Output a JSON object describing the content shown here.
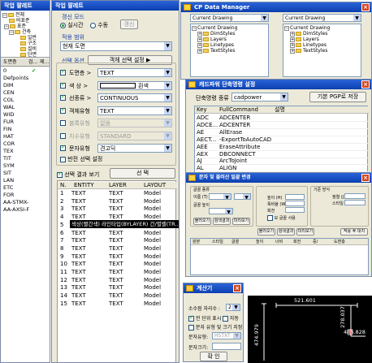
{
  "left_panel": {
    "title": "작업 팔레트",
    "tree": {
      "items": [
        "전체",
        "비표준",
        "표준",
        "건축",
        "일반",
        "구조",
        "설비",
        "단면",
        "도면"
      ],
      "table_headers": [
        "도면층",
        "검...",
        "제..."
      ],
      "layers": [
        "0",
        "Defpoints",
        "DIM",
        "CEN",
        "COL",
        "WAL",
        "WID",
        "FUR",
        "FIN",
        "HAT",
        "COR",
        "TEX",
        "TIT",
        "SYM",
        "SIT",
        "LAN",
        "ETC",
        "FOR",
        "AA-STMX-",
        "AA-AXSI-F"
      ]
    }
  },
  "right_panel": {
    "title": "작업 팔레트",
    "mode_group": "갱신 모드",
    "mode_options": [
      "실시간",
      "수동"
    ],
    "update_button": "갱신",
    "range_group": "적용 범위",
    "range_value": "현재 도면",
    "select_group": "선택 옵션",
    "select_button": "객체 선택 설정 ▶",
    "options": [
      {
        "label": "도면층 >",
        "value": "TEXT",
        "checked": true
      },
      {
        "label": "색    상 >",
        "value": "흰색",
        "checked": true
      },
      {
        "label": "선종류 >",
        "value": "CONTINUOUS",
        "checked": true
      },
      {
        "label": "객체유형",
        "value": "TEXT",
        "checked": true
      },
      {
        "label": "블록유형",
        "value": "없음",
        "checked": false
      },
      {
        "label": "치수유형",
        "value": "STANDARD",
        "checked": false
      },
      {
        "label": "문자유형",
        "value": "견고딕",
        "checked": true
      }
    ],
    "reverse_select": "반전 선택 설정",
    "show_result": "선택 결과 보기",
    "select_action_button": "선 택",
    "result_headers": [
      "N.",
      "ENTITY",
      "LAYER",
      "LAYOUT"
    ],
    "result_rows": [
      [
        "1",
        "TEXT",
        "TEXT",
        "Model"
      ],
      [
        "2",
        "TEXT",
        "TEXT",
        "Model"
      ],
      [
        "3",
        "TEXT",
        "TEXT",
        "Model"
      ],
      [
        "4",
        "TEXT",
        "TEXT",
        "Model"
      ],
      [
        "5",
        "",
        "",
        ""
      ],
      [
        "6",
        "TEXT",
        "TEXT",
        "Model"
      ],
      [
        "7",
        "TEXT",
        "TEXT",
        "Model"
      ],
      [
        "8",
        "TEXT",
        "TEXT",
        "Model"
      ],
      [
        "9",
        "TEXT",
        "TEXT",
        "Model"
      ],
      [
        "10",
        "TEXT",
        "TEXT",
        "Model"
      ],
      [
        "11",
        "TEXT",
        "TEXT",
        "Model"
      ],
      [
        "12",
        "TEXT",
        "TEXT",
        "Model"
      ],
      [
        "13",
        "TEXT",
        "TEXT",
        "Model"
      ],
      [
        "14",
        "TEXT",
        "TEXT",
        "Model"
      ],
      [
        "15",
        "TEXT",
        "TEXT",
        "Model"
      ]
    ],
    "tooltip": "색상(빨간색) 라인타입(BYLAYER) 간/별벨(TR...)"
  },
  "cp_data_manager": {
    "title": "CP Data Manager",
    "left_combo": "Current Drawing",
    "right_combo": "Current Drawing",
    "tree_root": "Current Drawing",
    "tree_children": [
      "DimStyles",
      "Layers",
      "Linetypes",
      "TextStyles"
    ]
  },
  "shortcut_window": {
    "title": "캐드파워 단축명령 설정",
    "type_label": "단축명령 종류",
    "type_value": "cadpower",
    "save_button": "기본 PGP로 저장",
    "headers": [
      "Key",
      "FullCommand",
      "설명"
    ],
    "rows": [
      [
        "ADC",
        "ADCENTER"
      ],
      [
        "ADCE...",
        "ADCENTER"
      ],
      [
        "AE",
        "AllErase"
      ],
      [
        "AECT...",
        "-ExportToAutoCAD"
      ],
      [
        "AEE",
        "EraseAttribute"
      ],
      [
        "AEX",
        "DBCONNECT"
      ],
      [
        "AJ",
        "ArcToJoint"
      ],
      [
        "AL",
        "ALIGN"
      ]
    ]
  },
  "text_tool_window": {
    "title": "문자 및 블러선 일괄 변경",
    "left_labels": [
      "글꼴 종류",
      "이름 (T)",
      "글꼴 높이"
    ],
    "middle_labels": [
      "높이 (H)",
      "폭비율 (W)",
      "회전"
    ],
    "right_labels": [
      "기준 방식",
      "정렬 (J)",
      "스타일"
    ],
    "checkbox_label": "모 글꼴 사용",
    "buttons": [
      "불러오기",
      "검색결과",
      "미리보기",
      "불러오기",
      "검색결과",
      "미리보기",
      "적용 후 대치"
    ],
    "list_headers": [
      "원본",
      "스타일",
      "글꼴",
      "높이",
      "너비",
      "회전",
      "중/",
      "도면층"
    ]
  },
  "calculator": {
    "title": "계산기",
    "decimal_label": "소수점 자리수 :",
    "decimal_value": "2",
    "options": [
      "전 단위 표시",
      "자동",
      "문자 유형 및 크기 지정"
    ],
    "style_label": "문자유형:",
    "style_value": "HSTXT",
    "height_label": "문자크기:",
    "height_value": "",
    "confirm_button": "확 인"
  },
  "drawing": {
    "dims": [
      "521.601",
      "278.037",
      "486.828",
      "474.979"
    ]
  }
}
